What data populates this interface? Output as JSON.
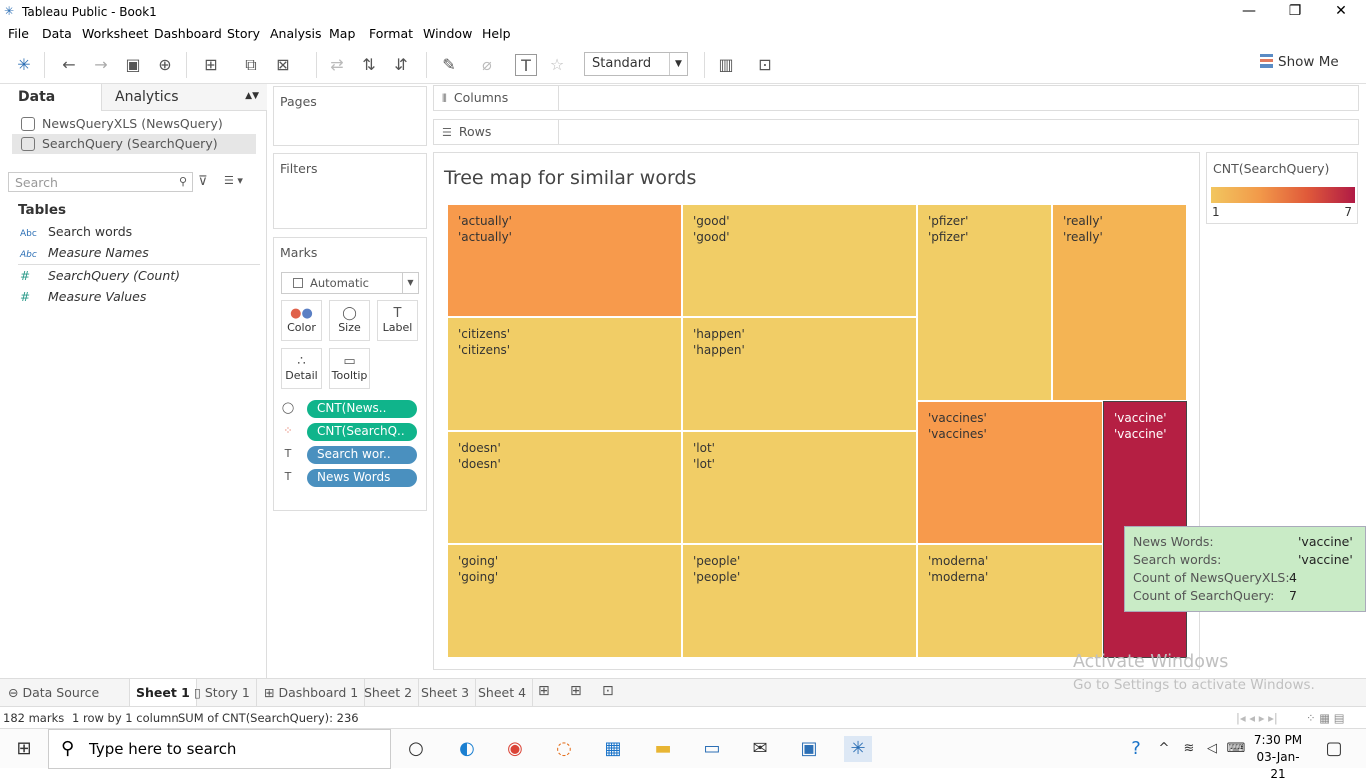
{
  "window": {
    "title": "Tableau Public - Book1"
  },
  "menu": [
    "File",
    "Data",
    "Worksheet",
    "Dashboard",
    "Story",
    "Analysis",
    "Map",
    "Format",
    "Window",
    "Help"
  ],
  "toolbar": {
    "fit_select": "Standard",
    "show_me": "Show Me"
  },
  "data_pane": {
    "tab_data": "Data",
    "tab_analytics": "Analytics",
    "sources": [
      "NewsQueryXLS (NewsQuery)",
      "SearchQuery (SearchQuery)"
    ],
    "search_placeholder": "Search",
    "tables_label": "Tables",
    "fields": [
      {
        "type": "Abc",
        "name": "Search words"
      },
      {
        "type": "Abc",
        "name": "Measure Names"
      },
      {
        "type": "#",
        "name": "SearchQuery (Count)"
      },
      {
        "type": "#",
        "name": "Measure Values"
      }
    ]
  },
  "cards": {
    "pages": "Pages",
    "filters": "Filters",
    "marks": "Marks",
    "mark_type": "Automatic",
    "mark_buttons": [
      "Color",
      "Size",
      "Label",
      "Detail",
      "Tooltip"
    ],
    "pills": [
      "CNT(News..",
      "CNT(SearchQ..",
      "Search wor..",
      "News Words"
    ]
  },
  "shelves": {
    "columns": "Columns",
    "rows": "Rows"
  },
  "viz": {
    "title": "Tree map for similar words",
    "cells": [
      {
        "l1": "'actually'",
        "l2": "'actually'",
        "count": 4
      },
      {
        "l1": "'good'",
        "l2": "'good'",
        "count": 2
      },
      {
        "l1": "'pfizer'",
        "l2": "'pfizer'",
        "count": 2
      },
      {
        "l1": "'really'",
        "l2": "'really'",
        "count": 3
      },
      {
        "l1": "'citizens'",
        "l2": "'citizens'",
        "count": 2
      },
      {
        "l1": "'happen'",
        "l2": "'happen'",
        "count": 2
      },
      {
        "l1": "'vaccines'",
        "l2": "'vaccines'",
        "count": 4
      },
      {
        "l1": "'vaccine'",
        "l2": "'vaccine'",
        "count": 7
      },
      {
        "l1": "'doesn'",
        "l2": "'doesn'",
        "count": 2
      },
      {
        "l1": "'lot'",
        "l2": "'lot'",
        "count": 2
      },
      {
        "l1": "'going'",
        "l2": "'going'",
        "count": 2
      },
      {
        "l1": "'people'",
        "l2": "'people'",
        "count": 2
      },
      {
        "l1": "'moderna'",
        "l2": "'moderna'",
        "count": 2
      }
    ]
  },
  "legend": {
    "title": "CNT(SearchQuery)",
    "min": "1",
    "max": "7"
  },
  "tooltip": {
    "rows": [
      {
        "k": "News Words:",
        "v": "'vaccine'"
      },
      {
        "k": "Search words:",
        "v": "'vaccine'"
      },
      {
        "k": "Count of NewsQueryXLS:",
        "v": "4"
      },
      {
        "k": "Count of SearchQuery:",
        "v": "7"
      }
    ]
  },
  "watermark": {
    "line1": "Activate Windows",
    "line2": "Go to Settings to activate Windows."
  },
  "sheet_tabs": {
    "data_source": "Data Source",
    "tabs": [
      "Sheet 1",
      "Story 1",
      "Dashboard 1",
      "Sheet 2",
      "Sheet 3",
      "Sheet 4"
    ]
  },
  "status": {
    "marks": "182 marks",
    "dims": "1 row by 1 column",
    "sum": "SUM of CNT(SearchQuery): 236"
  },
  "taskbar": {
    "search": "Type here to search",
    "time": "7:30 PM",
    "date": "03-Jan-21"
  }
}
